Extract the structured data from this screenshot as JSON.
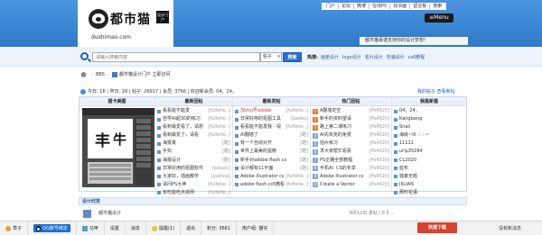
{
  "header": {
    "logo_text": "都市猫",
    "logo_badge": "设计门户",
    "domain": "dushimao.com",
    "nav": [
      "门户",
      "论坛",
      "微博",
      "在线PS",
      "找书画",
      "留言板",
      "搜索"
    ],
    "menu_label": "≡Menu",
    "notice": "都市猫承诺支持你的设计梦想！"
  },
  "search": {
    "placeholder": "请输入搜索内容",
    "select_value": "帖子",
    "button_label": "搜索",
    "hot_label": "热搜:",
    "hot_items": [
      "画册设计",
      "logo设计",
      "名片设计",
      "包装设计",
      "cs6教程"
    ]
  },
  "breadcrumb": {
    "items": [
      "BBS",
      "都市猫设计门户 立即访问"
    ],
    "sep": "›"
  },
  "stats": {
    "text": "今日: 16 | 昨日: 28 | 帖子: 26917 | 会员: 3766 | 欢迎新会员: 04，24。",
    "right": "我的帖子  查看新帖"
  },
  "grid": {
    "columns": [
      {
        "title": "猫卡美图",
        "items": []
      },
      {
        "title": "最新回帖",
        "items": [
          {
            "text": "看看能不能发",
            "meta": "[fulfetle..]"
          },
          {
            "text": "自学AI超3D的练习",
            "meta": "[fulfetle..]"
          },
          {
            "text": "看到最爱看了，请想",
            "meta": "[fulfetle..]"
          },
          {
            "text": "看到最爱了，请看",
            "meta": "[fulfetle..]"
          },
          {
            "text": "海报真",
            "meta": "[酷]"
          },
          {
            "text": "手扣",
            "meta": "[酷]"
          },
          {
            "text": "海报设计",
            "meta": "[酷]"
          },
          {
            "text": "非常好用的抠图软件",
            "meta": "[pxlacc]"
          },
          {
            "text": "大家好，插画教学",
            "meta": "[puthoa]"
          },
          {
            "text": "请问PS大神",
            "meta": "[fulfetle..]"
          },
          {
            "text": "有吃能吃点进网",
            "meta": "[fulfetle..]"
          }
        ]
      },
      {
        "title": "最新发帖",
        "items": [
          {
            "text": "加vinj号adobe",
            "meta": "[fulfetle..]"
          },
          {
            "text": "非常好用的抠图工具",
            "meta": "[panku]"
          },
          {
            "text": "看看能不能发我 - 视",
            "meta": "[fulfetle..]"
          },
          {
            "text": "AI翻墙了",
            "meta": "[酷]"
          },
          {
            "text": "有一个自动对齐",
            "meta": "[酷]"
          },
          {
            "text": "世界上最美的蛋糕",
            "meta": "[酷]"
          },
          {
            "text": "新手对adobe flash cs",
            "meta": "[酷]"
          },
          {
            "text": "设计都有11平面",
            "meta": "[酷]"
          },
          {
            "text": "Adobe Illustrator cs5",
            "meta": "[fulfetle..]"
          },
          {
            "text": "adobe flash cs5教程",
            "meta": "[fulfetle..]"
          }
        ]
      },
      {
        "title": "热门回帖",
        "items": [
          {
            "text": "A翻墙定空",
            "meta": "[Ps4520]"
          },
          {
            "text": "新手的资料望请",
            "meta": "[Ps4520]"
          },
          {
            "text": "路上第二课练习",
            "meta": "[Ps4520]"
          },
          {
            "text": "AI先攻克的免费",
            "meta": "[Ps4520]"
          },
          {
            "text": "拍片练习",
            "meta": "[Ps4520]"
          },
          {
            "text": "求大家帮忙看看",
            "meta": "[Ps4520]"
          },
          {
            "text": "PS正确全部教程",
            "meta": "[Ps4520]"
          },
          {
            "text": "手机Ai: CS的专享",
            "meta": "[Ps4520]"
          },
          {
            "text": "Adobe Illustrator cs",
            "meta": "[Ps4520]"
          },
          {
            "text": "Create a Vector",
            "meta": "[Ps4520]"
          }
        ]
      },
      {
        "title": "我是新猫",
        "items": [
          {
            "text": "04，24。"
          },
          {
            "text": "Kangbang"
          },
          {
            "text": "Snail"
          },
          {
            "text": "海底~lll ♢♢~"
          },
          {
            "text": "11111"
          },
          {
            "text": "urlp35284"
          },
          {
            "text": "CL2020"
          },
          {
            "text": "蓝布"
          },
          {
            "text": "独奏无题"
          },
          {
            "text": "JIILIAN"
          },
          {
            "text": "那时花语"
          }
        ]
      }
    ]
  },
  "design": {
    "title": "设计欣赏",
    "row_text": "都市猫设计",
    "row_right": "9月12日 发帖 / 0 5 ..."
  },
  "bottombar": {
    "user": "草子",
    "qq": "QQ账号绑定",
    "items": [
      "马甲",
      "设置",
      "消息",
      "提醒(1)",
      "退出",
      "积分: 3661",
      "用户组: 猫仔"
    ],
    "kaixin": "快速下载",
    "new_msg": "没有新消息"
  },
  "colors": {
    "brand_blue": "#3c86d6",
    "search_blue": "#2a6fcf",
    "alert_red": "#d7432f"
  }
}
